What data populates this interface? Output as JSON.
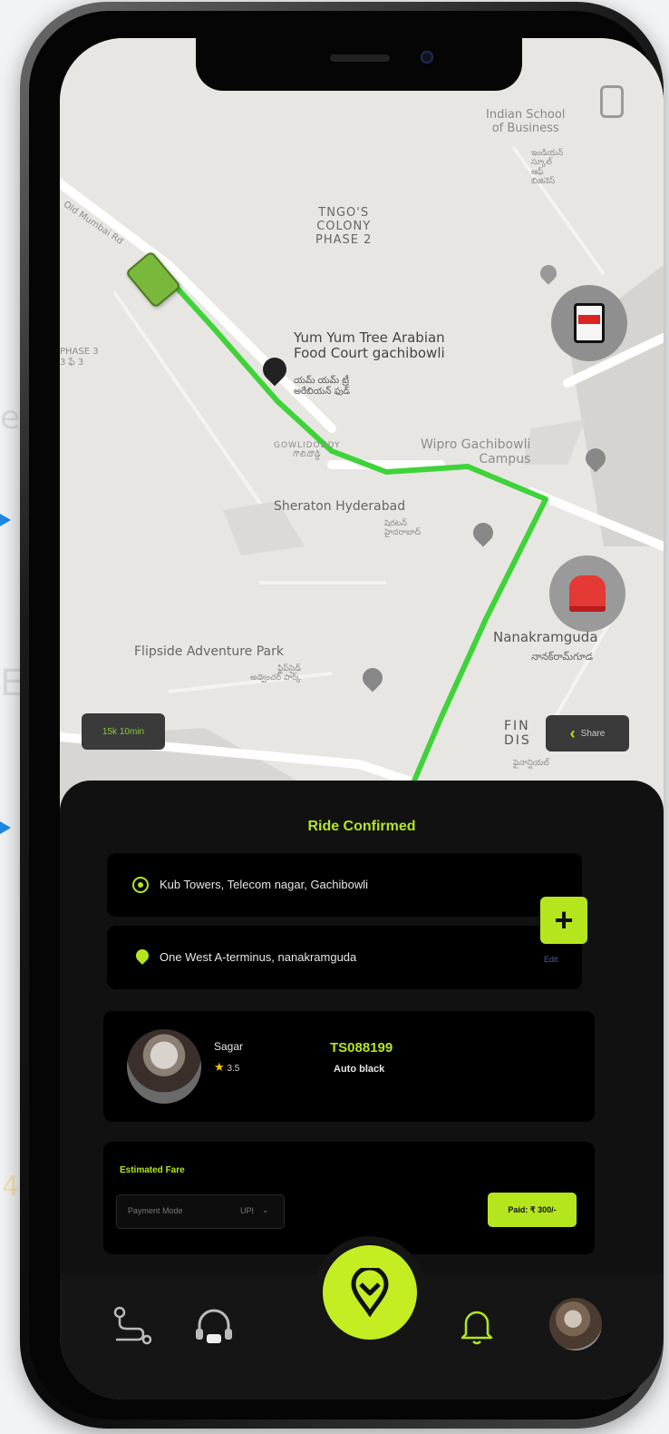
{
  "map": {
    "labels": {
      "indian_school": "Indian School\nof Business",
      "indian_school_te": "ఇండియన్\nస్కూల్\nఆఫ్\nబిజినెస్",
      "tngo": "TNGO'S\nCOLONY\nPHASE 2",
      "road": "Old Mumbai Rd",
      "phase3": "PHASE 3\n3 ఫే 3",
      "yumyum": "Yum Yum Tree Arabian\nFood Court gachibowli",
      "yumyum_te": "యమ్ యమ్ ట్రీ\nఅరేబియన్ ఫుడ్",
      "gowlidoddy": "GOWLIDODDY\nగౌలిదొడ్డి",
      "wipro": "Wipro Gachibowli\nCampus",
      "sheraton": "Sheraton Hyderabad",
      "sheraton_te": "షెరటన్\nహైదరాబాద్",
      "nanakramguda": "Nanakramguda",
      "nanakramguda_te": "నానక్‌రామ్‌గూడ",
      "flipside": "Flipside Adventure Park",
      "flipside_te": "ఫ్లిప్‌సైడ్\nఅడ్వెంచర్ పార్క్",
      "fin_district": "FIN\nDIS",
      "fin_district_te": "ఫైనాన్షియల్"
    },
    "eta_chip": "15k 10min",
    "share_label": "Share",
    "route_color": "#3fd33a",
    "vehicle_color": "#79b83a"
  },
  "ride": {
    "title": "Ride Confirmed",
    "pickup": "Kub Towers, Telecom nagar, Gachibowli",
    "drop": "One West A-terminus, nanakramguda",
    "add_stop_symbol": "+",
    "edit_label": "Edit"
  },
  "driver": {
    "name": "Sagar",
    "rating": "3.5",
    "vehicle_number": "TS088199",
    "vehicle_type": "Auto black"
  },
  "fare": {
    "label": "Estimated Fare",
    "payment_mode_label": "Payment Mode",
    "payment_value": "UPI",
    "pay_button": "Paid: ₹ 300/-"
  },
  "colors": {
    "accent": "#b5e61d",
    "background": "#111111",
    "card": "#000000"
  },
  "nav_icons": [
    "route-icon",
    "support-headset-icon",
    "location-pin-icon",
    "bell-icon",
    "profile-avatar"
  ]
}
